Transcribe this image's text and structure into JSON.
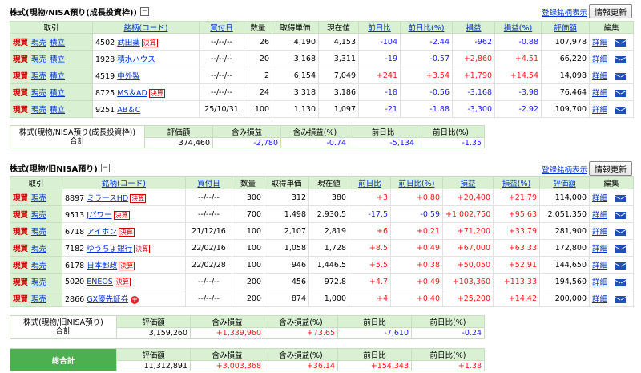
{
  "nisa_growth": {
    "title": "株式(現物/NISA預り(成長投資枠))",
    "collapse_symbol": "−",
    "register_link": "登録銘柄表示",
    "refresh_label": "情報更新",
    "headers": {
      "trade": "取引",
      "name": "銘柄(コード)",
      "date": "買付日",
      "qty": "数量",
      "cost": "取得単価",
      "price": "現在値",
      "prev": "前日比",
      "prev_pct": "前日比(%)",
      "pl": "損益",
      "pl_pct": "損益(%)",
      "value": "評価額",
      "edit": "編集"
    },
    "actions": [
      "現買",
      "現売",
      "積立"
    ],
    "rows": [
      {
        "code": "4502",
        "name": "武田薬",
        "badge": "決算",
        "date": "--/--/--",
        "qty": "26",
        "cost": "4,190",
        "price": "4,153",
        "prev": "-104",
        "prev_pct": "-2.44",
        "pl": "-962",
        "pl_pct": "-0.88",
        "value": "107,978",
        "detail": "詳細"
      },
      {
        "code": "1928",
        "name": "積水ハウス",
        "badge": "",
        "date": "--/--/--",
        "qty": "20",
        "cost": "3,168",
        "price": "3,311",
        "prev": "-19",
        "prev_pct": "-0.57",
        "pl": "+2,860",
        "pl_pct": "+4.51",
        "value": "66,220",
        "detail": "詳細"
      },
      {
        "code": "4519",
        "name": "中外製",
        "badge": "",
        "date": "--/--/--",
        "qty": "2",
        "cost": "6,154",
        "price": "7,049",
        "prev": "+241",
        "prev_pct": "+3.54",
        "pl": "+1,790",
        "pl_pct": "+14.54",
        "value": "14,098",
        "detail": "詳細"
      },
      {
        "code": "8725",
        "name": "MS＆AD",
        "badge": "決算",
        "date": "--/--/--",
        "qty": "24",
        "cost": "3,318",
        "price": "3,186",
        "prev": "-18",
        "prev_pct": "-0.56",
        "pl": "-3,168",
        "pl_pct": "-3.98",
        "value": "76,464",
        "detail": "詳細"
      },
      {
        "code": "9251",
        "name": "AB＆C",
        "badge": "",
        "date": "25/10/31",
        "qty": "100",
        "cost": "1,130",
        "price": "1,097",
        "prev": "-21",
        "prev_pct": "-1.88",
        "pl": "-3,300",
        "pl_pct": "-2.92",
        "value": "109,700",
        "detail": "詳細"
      }
    ],
    "summary": {
      "label1": "株式(現物/NISA預り(成長投資枠))",
      "label2": "合計",
      "h_value": "評価額",
      "h_pl": "含み損益",
      "h_pl_pct": "含み損益(%)",
      "h_prev": "前日比",
      "h_prev_pct": "前日比(%)",
      "value": "374,460",
      "pl": "-2,780",
      "pl_pct": "-0.74",
      "prev": "-5,134",
      "prev_pct": "-1.35"
    }
  },
  "nisa_old": {
    "title": "株式(現物/旧NISA預り)",
    "collapse_symbol": "−",
    "register_link": "登録銘柄表示",
    "refresh_label": "情報更新",
    "headers": {
      "trade": "取引",
      "name": "銘柄(コード)",
      "date": "買付日",
      "qty": "数量",
      "cost": "取得単価",
      "price": "現在値",
      "prev": "前日比",
      "prev_pct": "前日比(%)",
      "pl": "損益",
      "pl_pct": "損益(%)",
      "value": "評価額",
      "edit": "編集"
    },
    "actions": [
      "現買",
      "現売"
    ],
    "rows": [
      {
        "code": "8897",
        "name": "ミラースHD",
        "badge": "決算",
        "plus": "",
        "date": "--/--/--",
        "qty": "300",
        "cost": "312",
        "price": "380",
        "prev": "+3",
        "prev_pct": "+0.80",
        "pl": "+20,400",
        "pl_pct": "+21.79",
        "value": "114,000",
        "detail": "詳細"
      },
      {
        "code": "9513",
        "name": "Jパワー",
        "badge": "決算",
        "plus": "",
        "date": "--/--/--",
        "qty": "700",
        "cost": "1,498",
        "price": "2,930.5",
        "prev": "-17.5",
        "prev_pct": "-0.59",
        "pl": "+1,002,750",
        "pl_pct": "+95.63",
        "value": "2,051,350",
        "detail": "詳細"
      },
      {
        "code": "6718",
        "name": "アイホン",
        "badge": "決算",
        "plus": "",
        "date": "21/12/16",
        "qty": "100",
        "cost": "2,107",
        "price": "2,819",
        "prev": "+6",
        "prev_pct": "+0.21",
        "pl": "+71,200",
        "pl_pct": "+33.79",
        "value": "281,900",
        "detail": "詳細"
      },
      {
        "code": "7182",
        "name": "ゆうちょ銀行",
        "badge": "決算",
        "plus": "",
        "date": "22/02/16",
        "qty": "100",
        "cost": "1,058",
        "price": "1,728",
        "prev": "+8.5",
        "prev_pct": "+0.49",
        "pl": "+67,000",
        "pl_pct": "+63.33",
        "value": "172,800",
        "detail": "詳細"
      },
      {
        "code": "6178",
        "name": "日本郵政",
        "badge": "決算",
        "plus": "",
        "date": "22/02/28",
        "qty": "100",
        "cost": "946",
        "price": "1,446.5",
        "prev": "+5.5",
        "prev_pct": "+0.38",
        "pl": "+50,050",
        "pl_pct": "+52.91",
        "value": "144,650",
        "detail": "詳細"
      },
      {
        "code": "5020",
        "name": "ENEOS",
        "badge": "決算",
        "plus": "",
        "date": "--/--/--",
        "qty": "200",
        "cost": "456",
        "price": "972.8",
        "prev": "+4.7",
        "prev_pct": "+0.49",
        "pl": "+103,360",
        "pl_pct": "+113.33",
        "value": "194,560",
        "detail": "詳細"
      },
      {
        "code": "2866",
        "name": "GX優先証券",
        "badge": "",
        "plus": "+",
        "date": "--/--/--",
        "qty": "200",
        "cost": "874",
        "price": "1,000",
        "prev": "+4",
        "prev_pct": "+0.40",
        "pl": "+25,200",
        "pl_pct": "+14.42",
        "value": "200,000",
        "detail": "詳細"
      }
    ],
    "summary": {
      "label1": "株式(現物/旧NISA預り)",
      "label2": "合計",
      "h_value": "評価額",
      "h_pl": "含み損益",
      "h_pl_pct": "含み損益(%)",
      "h_prev": "前日比",
      "h_prev_pct": "前日比(%)",
      "value": "3,159,260",
      "pl": "+1,339,960",
      "pl_pct": "+73.65",
      "prev": "-7,610",
      "prev_pct": "-0.24"
    }
  },
  "total": {
    "label": "総合計",
    "h_value": "評価額",
    "h_pl": "含み損益",
    "h_pl_pct": "含み損益(%)",
    "h_prev": "前日比",
    "h_prev_pct": "前日比(%)",
    "value": "11,312,891",
    "pl": "+3,003,368",
    "pl_pct": "+36.14",
    "prev": "+154,343",
    "prev_pct": "+1.38"
  },
  "colors": {
    "header_green": "#d9f0d2",
    "total_green": "#4caf50",
    "positive": "#ff1a1a",
    "negative": "#1a1aff",
    "link": "#0033cc"
  }
}
